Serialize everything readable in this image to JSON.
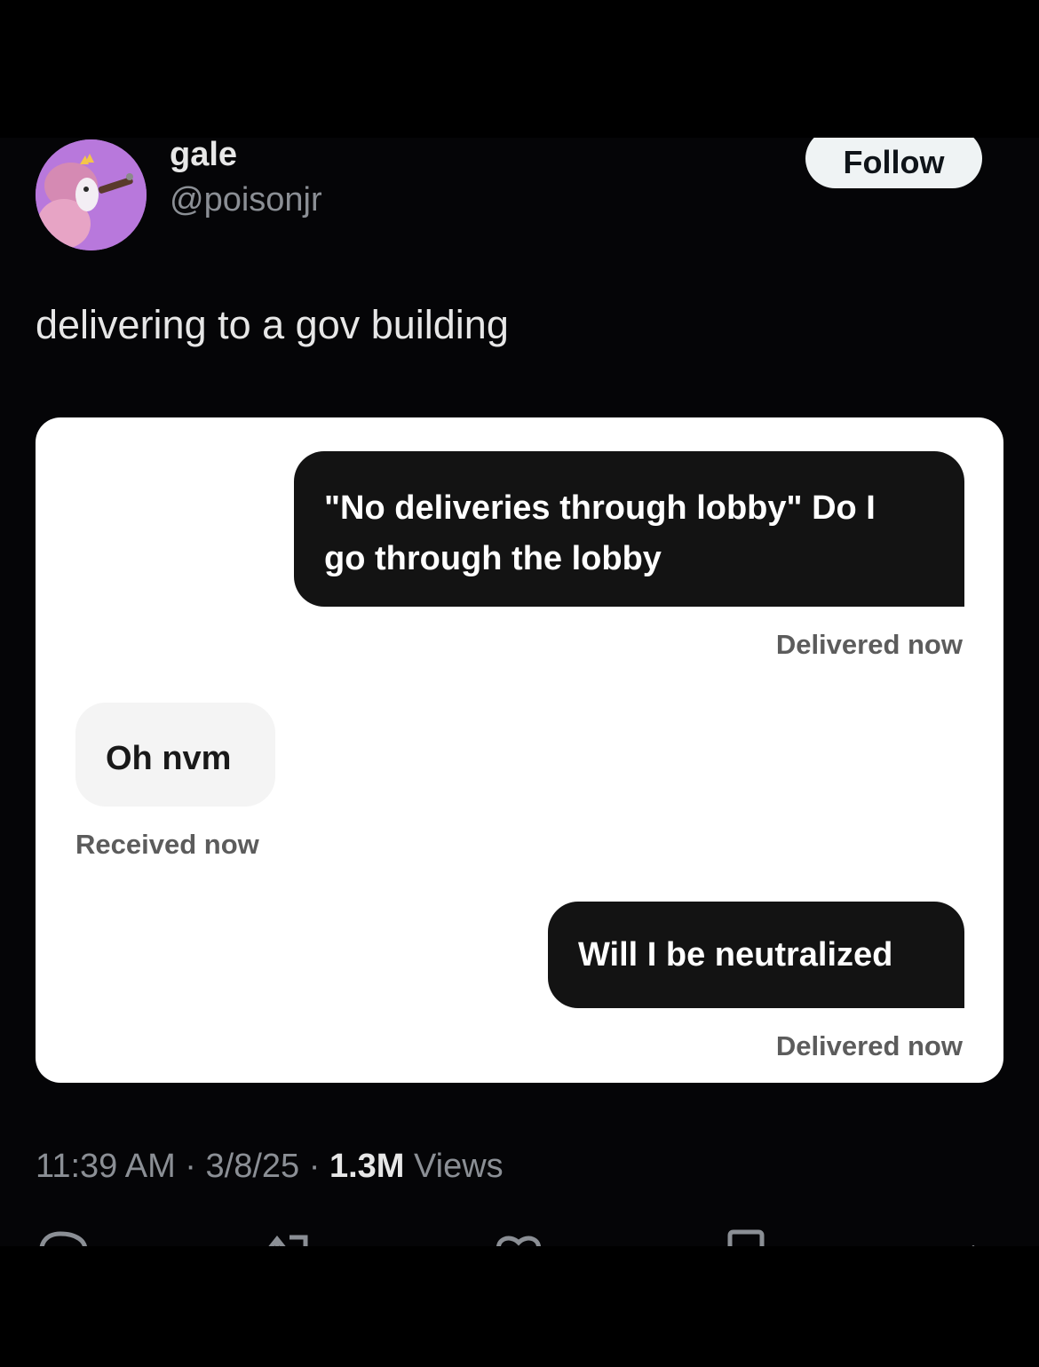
{
  "post": {
    "author": {
      "display_name": "gale",
      "handle": "@poisonjr",
      "avatar_icon": "cartoon-character-avatar-icon"
    },
    "follow_label": "Follow",
    "text": "delivering to a gov building",
    "timestamp": "11:39 AM",
    "date": "3/8/25",
    "separator": " · ",
    "views_count": "1.3M",
    "views_label": " Views"
  },
  "screenshot": {
    "messages": [
      {
        "direction": "outgoing",
        "lines": [
          "\"No deliveries through lobby\" Do I",
          "go through the lobby"
        ],
        "status": "Delivered now"
      },
      {
        "direction": "incoming",
        "lines": [
          "Oh nvm"
        ],
        "status": "Received now"
      },
      {
        "direction": "outgoing",
        "lines": [
          "Will I be neutralized"
        ],
        "status": "Delivered now"
      }
    ]
  },
  "actions": {
    "icons": [
      "reply-icon",
      "repost-icon",
      "like-icon",
      "bookmark-icon",
      "share-icon"
    ]
  },
  "colors": {
    "background": "#000000",
    "follow_button_bg": "#eff3f4",
    "bubble_outgoing": "#131313",
    "bubble_incoming": "#f4f4f4",
    "muted_text": "#8b8f95"
  }
}
